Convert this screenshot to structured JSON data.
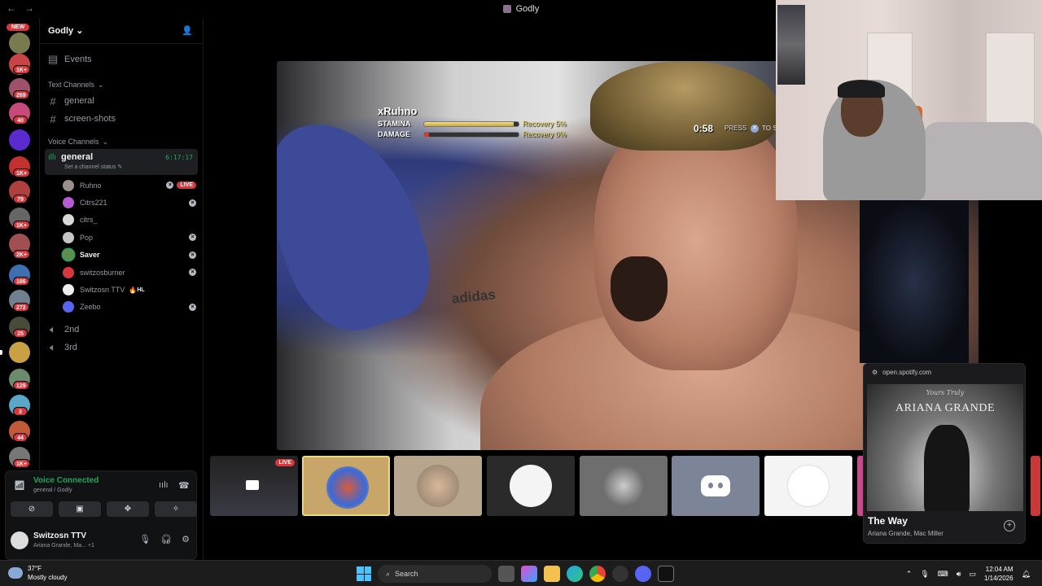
{
  "window": {
    "title": "Godly"
  },
  "rail": {
    "new_label": "NEW",
    "badges": [
      "1K+",
      "269",
      "40",
      "1K+",
      "79",
      "1K+",
      "2K+",
      "186",
      "272",
      "25",
      "129",
      "3",
      "44",
      "1K+"
    ]
  },
  "server": {
    "name": "Godly",
    "events_label": "Events",
    "text_category": "Text Channels",
    "text_channels": [
      "general",
      "screen-shots"
    ],
    "voice_category": "Voice Channels",
    "active_voice": {
      "name": "general",
      "timer": "6:17:17",
      "status_placeholder": "Set a channel status",
      "users": [
        {
          "name": "Ruhno",
          "live": "LIVE",
          "color": "#9a8f8a"
        },
        {
          "name": "Citrs221",
          "color": "#b65ad6"
        },
        {
          "name": "citrs_",
          "color": "#d8d8d8"
        },
        {
          "name": "Pop",
          "color": "#c6c6c6"
        },
        {
          "name": "Saver",
          "color": "#5f8d4e"
        },
        {
          "name": "switzosburner",
          "color": "#da373c"
        },
        {
          "name": "Switzosn TTV",
          "tag": "HL",
          "color": "#eeeeee"
        },
        {
          "name": "Zeebo",
          "color": "#5865f2"
        }
      ]
    },
    "other_voice": [
      "2nd",
      "3rd"
    ]
  },
  "voice_panel": {
    "status": "Voice Connected",
    "location": "general / Godly",
    "user_name": "Switzosn TTV",
    "user_status": "Ariana Grande, Ma... +1"
  },
  "game_hud": {
    "player": "xRuhno",
    "stamina_label": "STAMINA",
    "damage_label": "DAMAGE",
    "stamina_recovery": "Recovery  5%",
    "damage_recovery": "Recovery  0%",
    "stamina_level": 0.95,
    "damage_level": 0.05,
    "timer": "0:58",
    "press_label": "PRESS",
    "press_tail": "TO S",
    "shirt_text": "adidas"
  },
  "thumbnails": {
    "live_label": "LIVE"
  },
  "spotify": {
    "url": "open.spotify.com",
    "album_artist": "ARIANA GRANDE",
    "album_script": "Yours Truly",
    "song": "The Way",
    "artists": "Ariana Grande, Mac Miller"
  },
  "taskbar": {
    "temp": "37°F",
    "weather": "Mostly cloudy",
    "search": "Search",
    "time": "12:04 AM",
    "date": "1/14/2026"
  }
}
